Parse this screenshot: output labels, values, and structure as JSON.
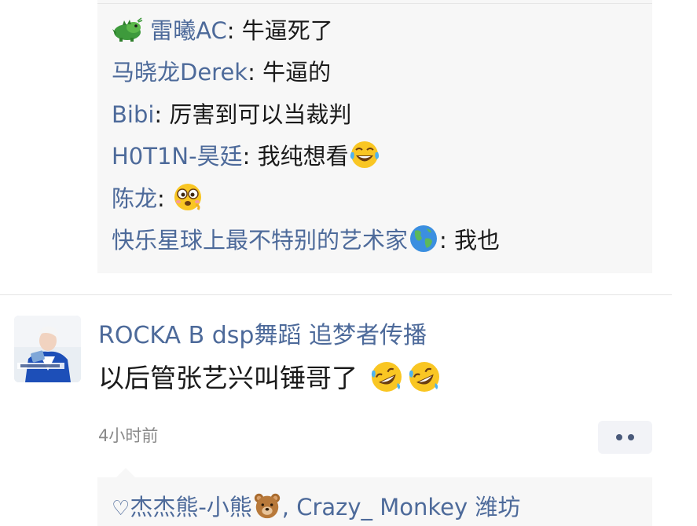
{
  "replies": [
    {
      "name": "雷曦AC",
      "text": "牛逼死了",
      "icon": "dragon-icon"
    },
    {
      "name": "马晓龙Derek",
      "text": "牛逼的"
    },
    {
      "name": "Bibi",
      "text": "厉害到可以当裁判"
    },
    {
      "name": "H0T1N-昊廷",
      "text": "我纯想看",
      "icon": "laughing-tears-icon"
    },
    {
      "name": "陈龙",
      "text": "",
      "icon": "dizzy-face-icon"
    },
    {
      "name": "快乐星球上最不特别的艺术家",
      "text": "我也",
      "icon": "globe-icon"
    }
  ],
  "separator": ":",
  "comment": {
    "author": "ROCKA B dsp舞蹈 追梦者传播",
    "text": "以后管张艺兴叫锤哥了",
    "emoji_icons": [
      "rolling-laugh-icon",
      "rolling-laugh-icon"
    ],
    "time": "4小时前"
  },
  "likes": {
    "heart_icon": "♡",
    "users": [
      "杰杰熊-小熊",
      "Crazy_ Monkey 潍坊"
    ],
    "bear_icon": "bear-icon"
  },
  "colors": {
    "name": "#4d6a9a",
    "panel": "#f7f7f7"
  }
}
